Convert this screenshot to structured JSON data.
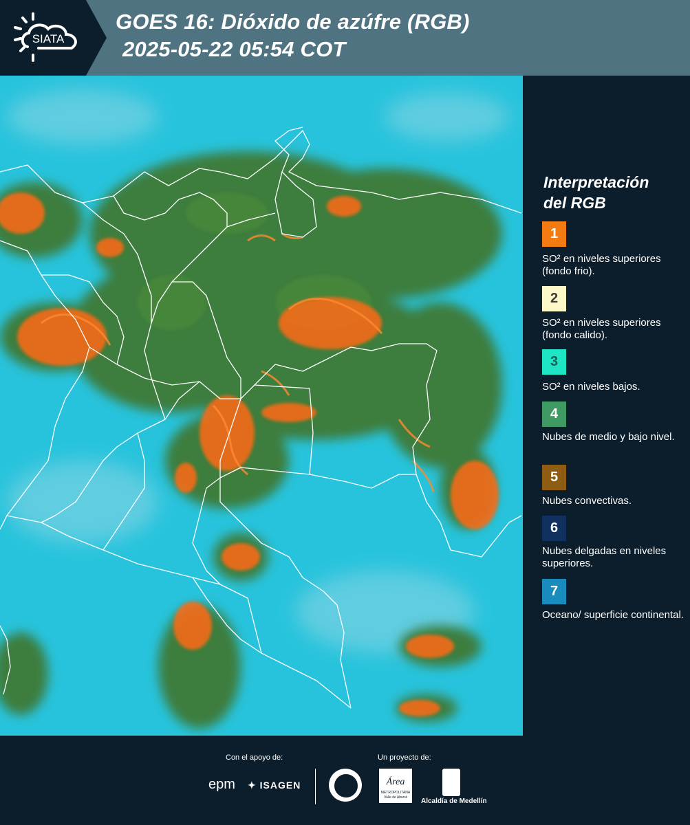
{
  "header": {
    "logo_text": "SIATA",
    "title_line1": "GOES 16: Dióxido de azúfre (RGB)",
    "title_line2": "2025-05-22 05:54 COT"
  },
  "map": {
    "colors": {
      "ocean_surface": "#27c3dc",
      "mid_low_clouds": "#3e7d3c",
      "convective": "#ff6a14",
      "borders": "#ffffff"
    }
  },
  "legend": {
    "title_line1": "Interpretación",
    "title_line2": "del RGB",
    "items": [
      {
        "number": "1",
        "color": "#f47a12",
        "text_color": "#ffffff",
        "label": "SO² en niveles superiores (fondo frio)."
      },
      {
        "number": "2",
        "color": "#fdf8c8",
        "text_color": "#3a3a3a",
        "label": "SO² en niveles superiores (fondo calido)."
      },
      {
        "number": "3",
        "color": "#1ee6c4",
        "text_color": "#225b55",
        "label": "SO² en niveles bajos."
      },
      {
        "number": "4",
        "color": "#3e9a62",
        "text_color": "#ffffff",
        "label": "Nubes de medio y bajo nivel."
      },
      {
        "number": "5",
        "color": "#8e5c12",
        "text_color": "#ffffff",
        "label": "Nubes convectivas."
      },
      {
        "number": "6",
        "color": "#103060",
        "text_color": "#ffffff",
        "label": "Nubes delgadas en niveles superiores."
      },
      {
        "number": "7",
        "color": "#1a8bbd",
        "text_color": "#ffffff",
        "label": "Oceano/ superficie continental."
      }
    ]
  },
  "footer": {
    "support_label": "Con el apoyo de:",
    "project_label": "Un proyecto de:",
    "epm_logo": "epm",
    "isagen_logo": "ISAGEN",
    "area_logo": "Área",
    "area_sub": "METROPOLITANA",
    "area_sub2": "Valle de Aburrá",
    "alcaldia_logo": "Alcaldía de Medellín"
  }
}
